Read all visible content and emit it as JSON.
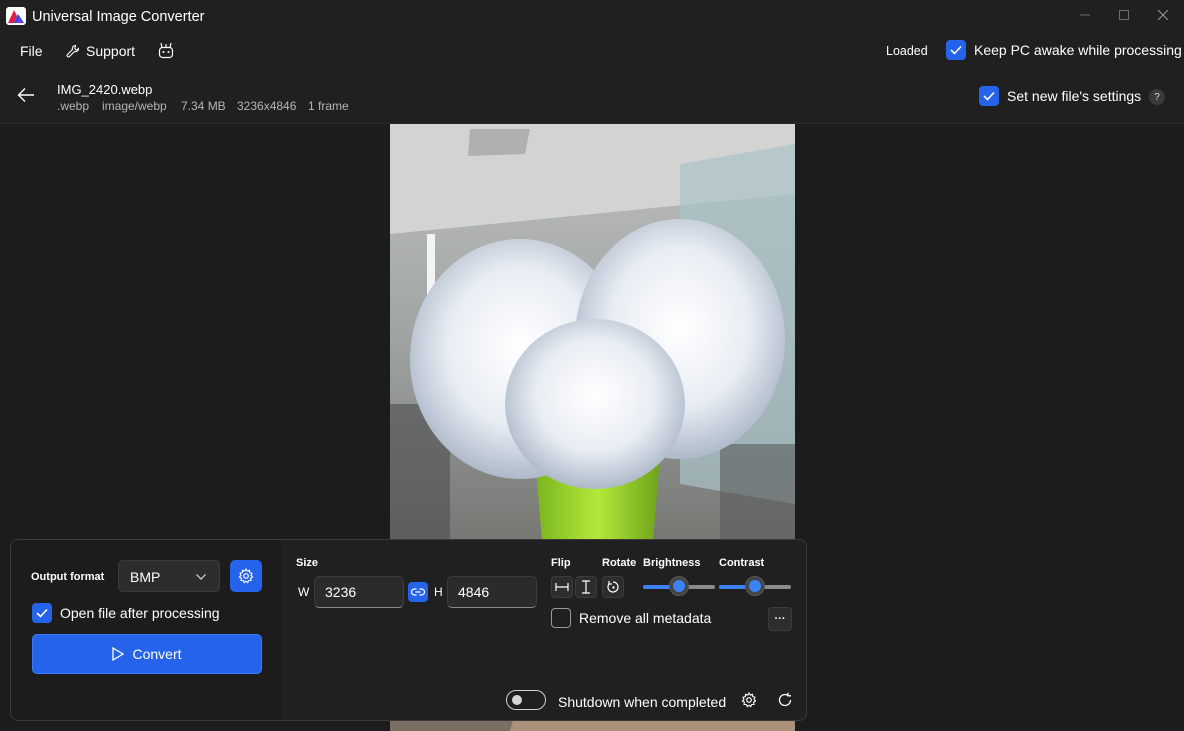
{
  "window": {
    "title": "Universal Image Converter"
  },
  "menu": {
    "file": "File",
    "support": "Support",
    "status": "Loaded",
    "keep_awake": "Keep PC awake while processing",
    "keep_awake_checked": true
  },
  "file": {
    "name": "IMG_2420.webp",
    "extension": ".webp",
    "mime": "image/webp",
    "size": "7.34 MB",
    "dimensions": "3236x4846",
    "frames": "1 frame",
    "set_new_settings": "Set new file's settings",
    "set_new_settings_checked": true,
    "help": "?"
  },
  "panel": {
    "output_format_label": "Output format",
    "output_format_value": "BMP",
    "open_after_label": "Open file after processing",
    "open_after_checked": true,
    "convert_label": "Convert",
    "size_label": "Size",
    "width_label": "W",
    "width_value": "3236",
    "height_label": "H",
    "height_value": "4846",
    "flip_label": "Flip",
    "rotate_label": "Rotate",
    "brightness_label": "Brightness",
    "brightness_value": 0.5,
    "contrast_label": "Contrast",
    "contrast_value": 0.5,
    "remove_metadata_label": "Remove all metadata",
    "remove_metadata_checked": false,
    "more": "···",
    "shutdown_label": "Shutdown when completed",
    "shutdown_on": false
  },
  "colors": {
    "accent": "#2563eb",
    "background": "#1c1c1c",
    "surface": "#202020"
  }
}
